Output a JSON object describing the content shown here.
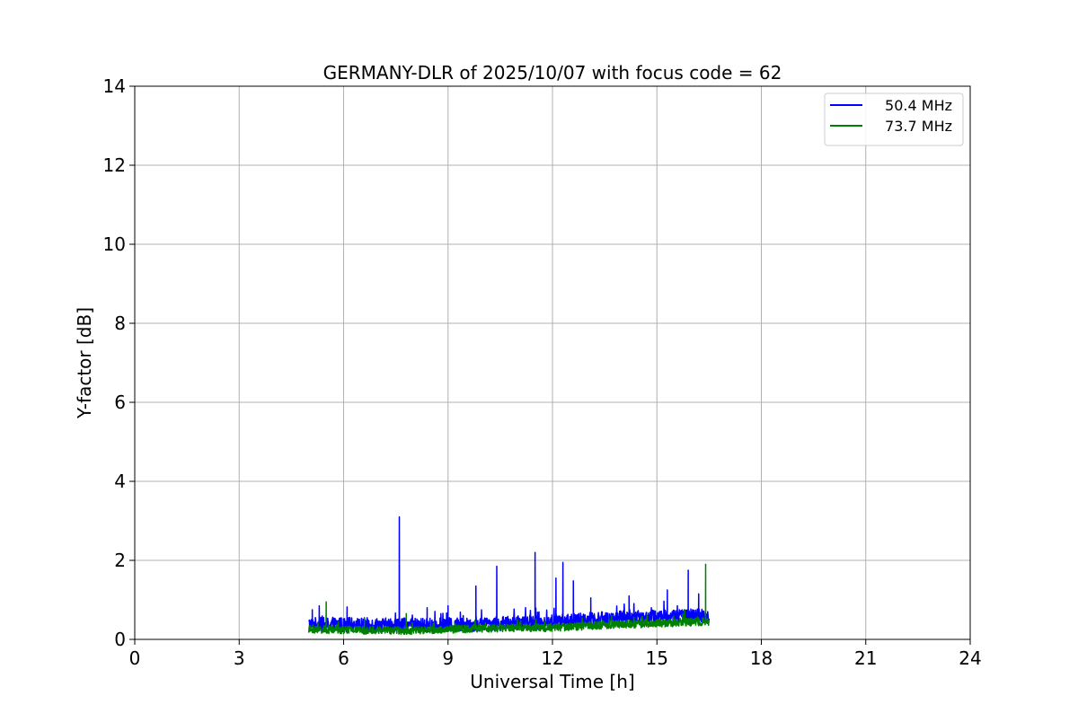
{
  "chart_data": {
    "type": "line",
    "title": "GERMANY-DLR of 2025/10/07 with focus code = 62",
    "xlabel": "Universal Time [h]",
    "ylabel": "Y-factor [dB]",
    "xlim": [
      0,
      24
    ],
    "ylim": [
      0,
      14
    ],
    "xticks": [
      0,
      3,
      6,
      9,
      12,
      15,
      18,
      21,
      24
    ],
    "yticks": [
      0,
      2,
      4,
      6,
      8,
      10,
      12,
      14
    ],
    "grid": true,
    "legend_position": "top-right",
    "series": [
      {
        "name": "50.4 MHz",
        "color": "#0000ff",
        "x_range": [
          5.0,
          16.5
        ],
        "baseline": [
          [
            5.0,
            0.38
          ],
          [
            8.0,
            0.36
          ],
          [
            10.0,
            0.38
          ],
          [
            12.0,
            0.45
          ],
          [
            14.0,
            0.55
          ],
          [
            16.5,
            0.6
          ]
        ],
        "noise_amplitude": 0.18,
        "peaks": [
          [
            5.1,
            0.75
          ],
          [
            5.3,
            0.85
          ],
          [
            6.1,
            0.82
          ],
          [
            7.6,
            3.1
          ],
          [
            8.4,
            0.8
          ],
          [
            9.0,
            0.85
          ],
          [
            9.8,
            1.35
          ],
          [
            10.4,
            1.85
          ],
          [
            11.5,
            2.2
          ],
          [
            12.1,
            1.55
          ],
          [
            12.3,
            1.95
          ],
          [
            12.6,
            1.48
          ],
          [
            13.1,
            1.05
          ],
          [
            14.2,
            1.1
          ],
          [
            15.3,
            1.25
          ],
          [
            15.9,
            1.75
          ],
          [
            16.2,
            1.15
          ]
        ]
      },
      {
        "name": "73.7 MHz",
        "color": "#008000",
        "x_range": [
          5.0,
          16.5
        ],
        "baseline": [
          [
            5.0,
            0.25
          ],
          [
            8.0,
            0.22
          ],
          [
            10.0,
            0.28
          ],
          [
            12.0,
            0.3
          ],
          [
            14.0,
            0.38
          ],
          [
            16.5,
            0.45
          ]
        ],
        "noise_amplitude": 0.1,
        "peaks": [
          [
            5.5,
            0.95
          ],
          [
            6.6,
            0.55
          ],
          [
            7.8,
            0.65
          ],
          [
            13.7,
            0.6
          ],
          [
            15.8,
            0.75
          ],
          [
            16.4,
            1.9
          ]
        ]
      }
    ]
  }
}
